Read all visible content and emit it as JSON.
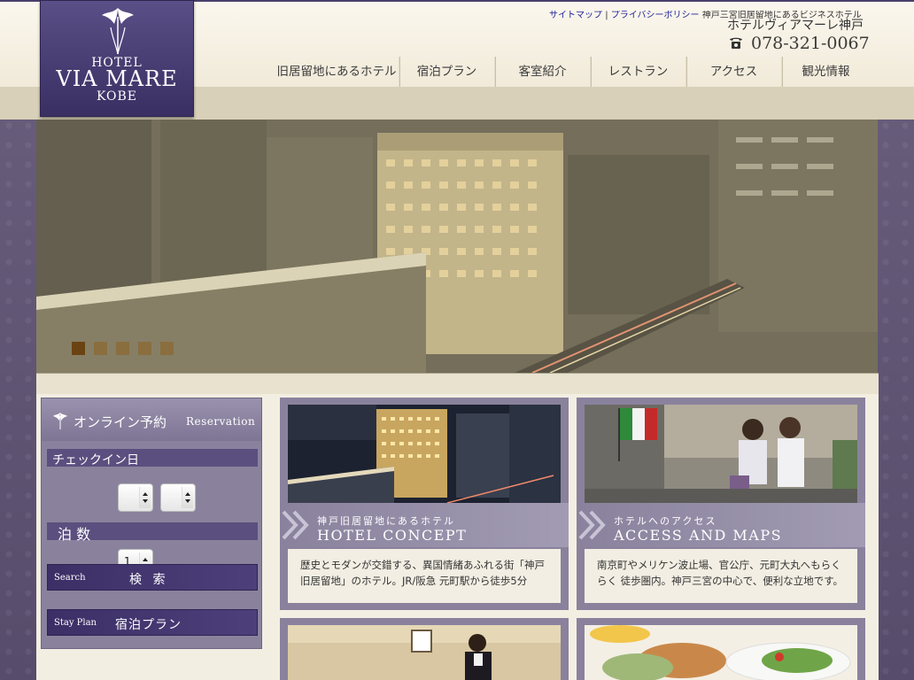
{
  "brand": {
    "logo_line1": "HOTEL",
    "logo_line2": "VIA MARE",
    "logo_line3": "KOBE"
  },
  "header": {
    "links": [
      "サイトマップ",
      "プライバシーポリシー"
    ],
    "link_separator": "|",
    "tagline": "神戸三宮旧居留地にあるビジネスホテル",
    "hotel_name": "ホテルヴィアマーレ神戸",
    "phone": "078-321-0067"
  },
  "nav": {
    "items": [
      "旧居留地にあるホテル",
      "宿泊プラン",
      "客室紹介",
      "レストラン",
      "アクセス",
      "観光情報"
    ]
  },
  "slideshow": {
    "slide_count": 5,
    "active_index": 0
  },
  "reservation": {
    "title_jp": "オンライン予約",
    "title_en": "Reservation",
    "checkin_label": "チェックイン日",
    "month_value": "",
    "day_value": "",
    "nights_label": "泊 数",
    "nights_value": "1",
    "search_en": "Search",
    "search_jp": "検 索",
    "plan_en": "Stay Plan",
    "plan_jp": "宿泊プラン"
  },
  "cards": [
    {
      "subtitle": "神戸旧居留地にあるホテル",
      "title": "HOTEL CONCEPT",
      "description": "歴史とモダンが交錯する、異国情緒あふれる街「神戸旧居留地」のホテル。JR/阪急 元町駅から徒歩5分"
    },
    {
      "subtitle": "ホテルへのアクセス",
      "title": "ACCESS AND MAPS",
      "description": "南京町やメリケン波止場、官公庁、元町大丸へもらくらく 徒歩圏内。神戸三宮の中心で、便利な立地です。"
    }
  ],
  "colors": {
    "brand_purple": "#3a2f63",
    "header_cream": "#fbf7ee",
    "card_lavender": "#8a829d",
    "dot_active": "#6b4313"
  }
}
